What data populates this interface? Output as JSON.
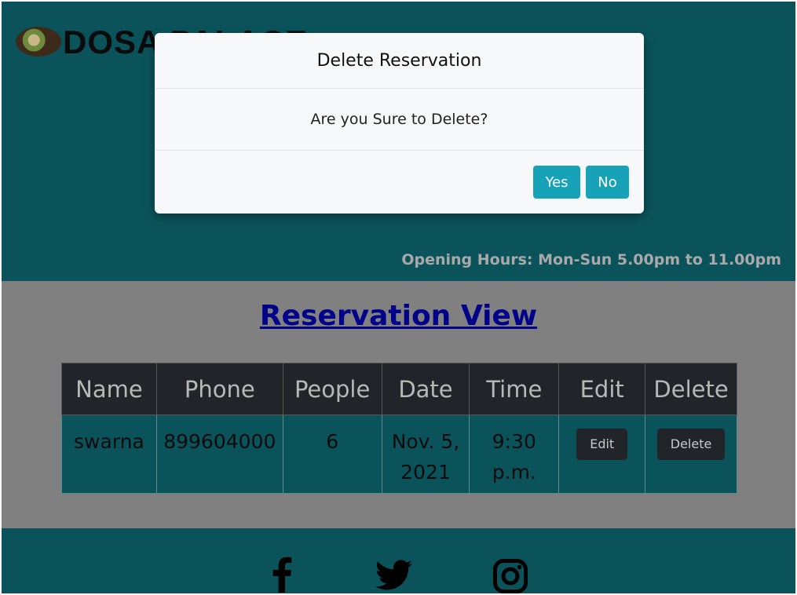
{
  "brand": {
    "name": "DOSA PALACE",
    "logo": "dosa-plate-logo"
  },
  "header": {
    "opening_hours": "Opening Hours: Mon-Sun 5.00pm to 11.00pm"
  },
  "main": {
    "title": "Reservation View",
    "table": {
      "headers": [
        "Name",
        "Phone",
        "People",
        "Date",
        "Time",
        "Edit",
        "Delete"
      ],
      "rows": [
        {
          "name": "swarna",
          "phone": "899604000",
          "people": "6",
          "date": "Nov. 5, 2021",
          "time": "9:30 p.m.",
          "edit_label": "Edit",
          "delete_label": "Delete"
        }
      ]
    }
  },
  "footer": {
    "icons": [
      "facebook-icon",
      "twitter-icon",
      "instagram-icon"
    ]
  },
  "modal": {
    "title": "Delete Reservation",
    "message": "Are you Sure to Delete?",
    "yes_label": "Yes",
    "no_label": "No"
  },
  "colors": {
    "teal": "#0a535b",
    "gray": "#808080",
    "dark": "#212529",
    "info": "#17a2b8",
    "link": "#00008b"
  }
}
